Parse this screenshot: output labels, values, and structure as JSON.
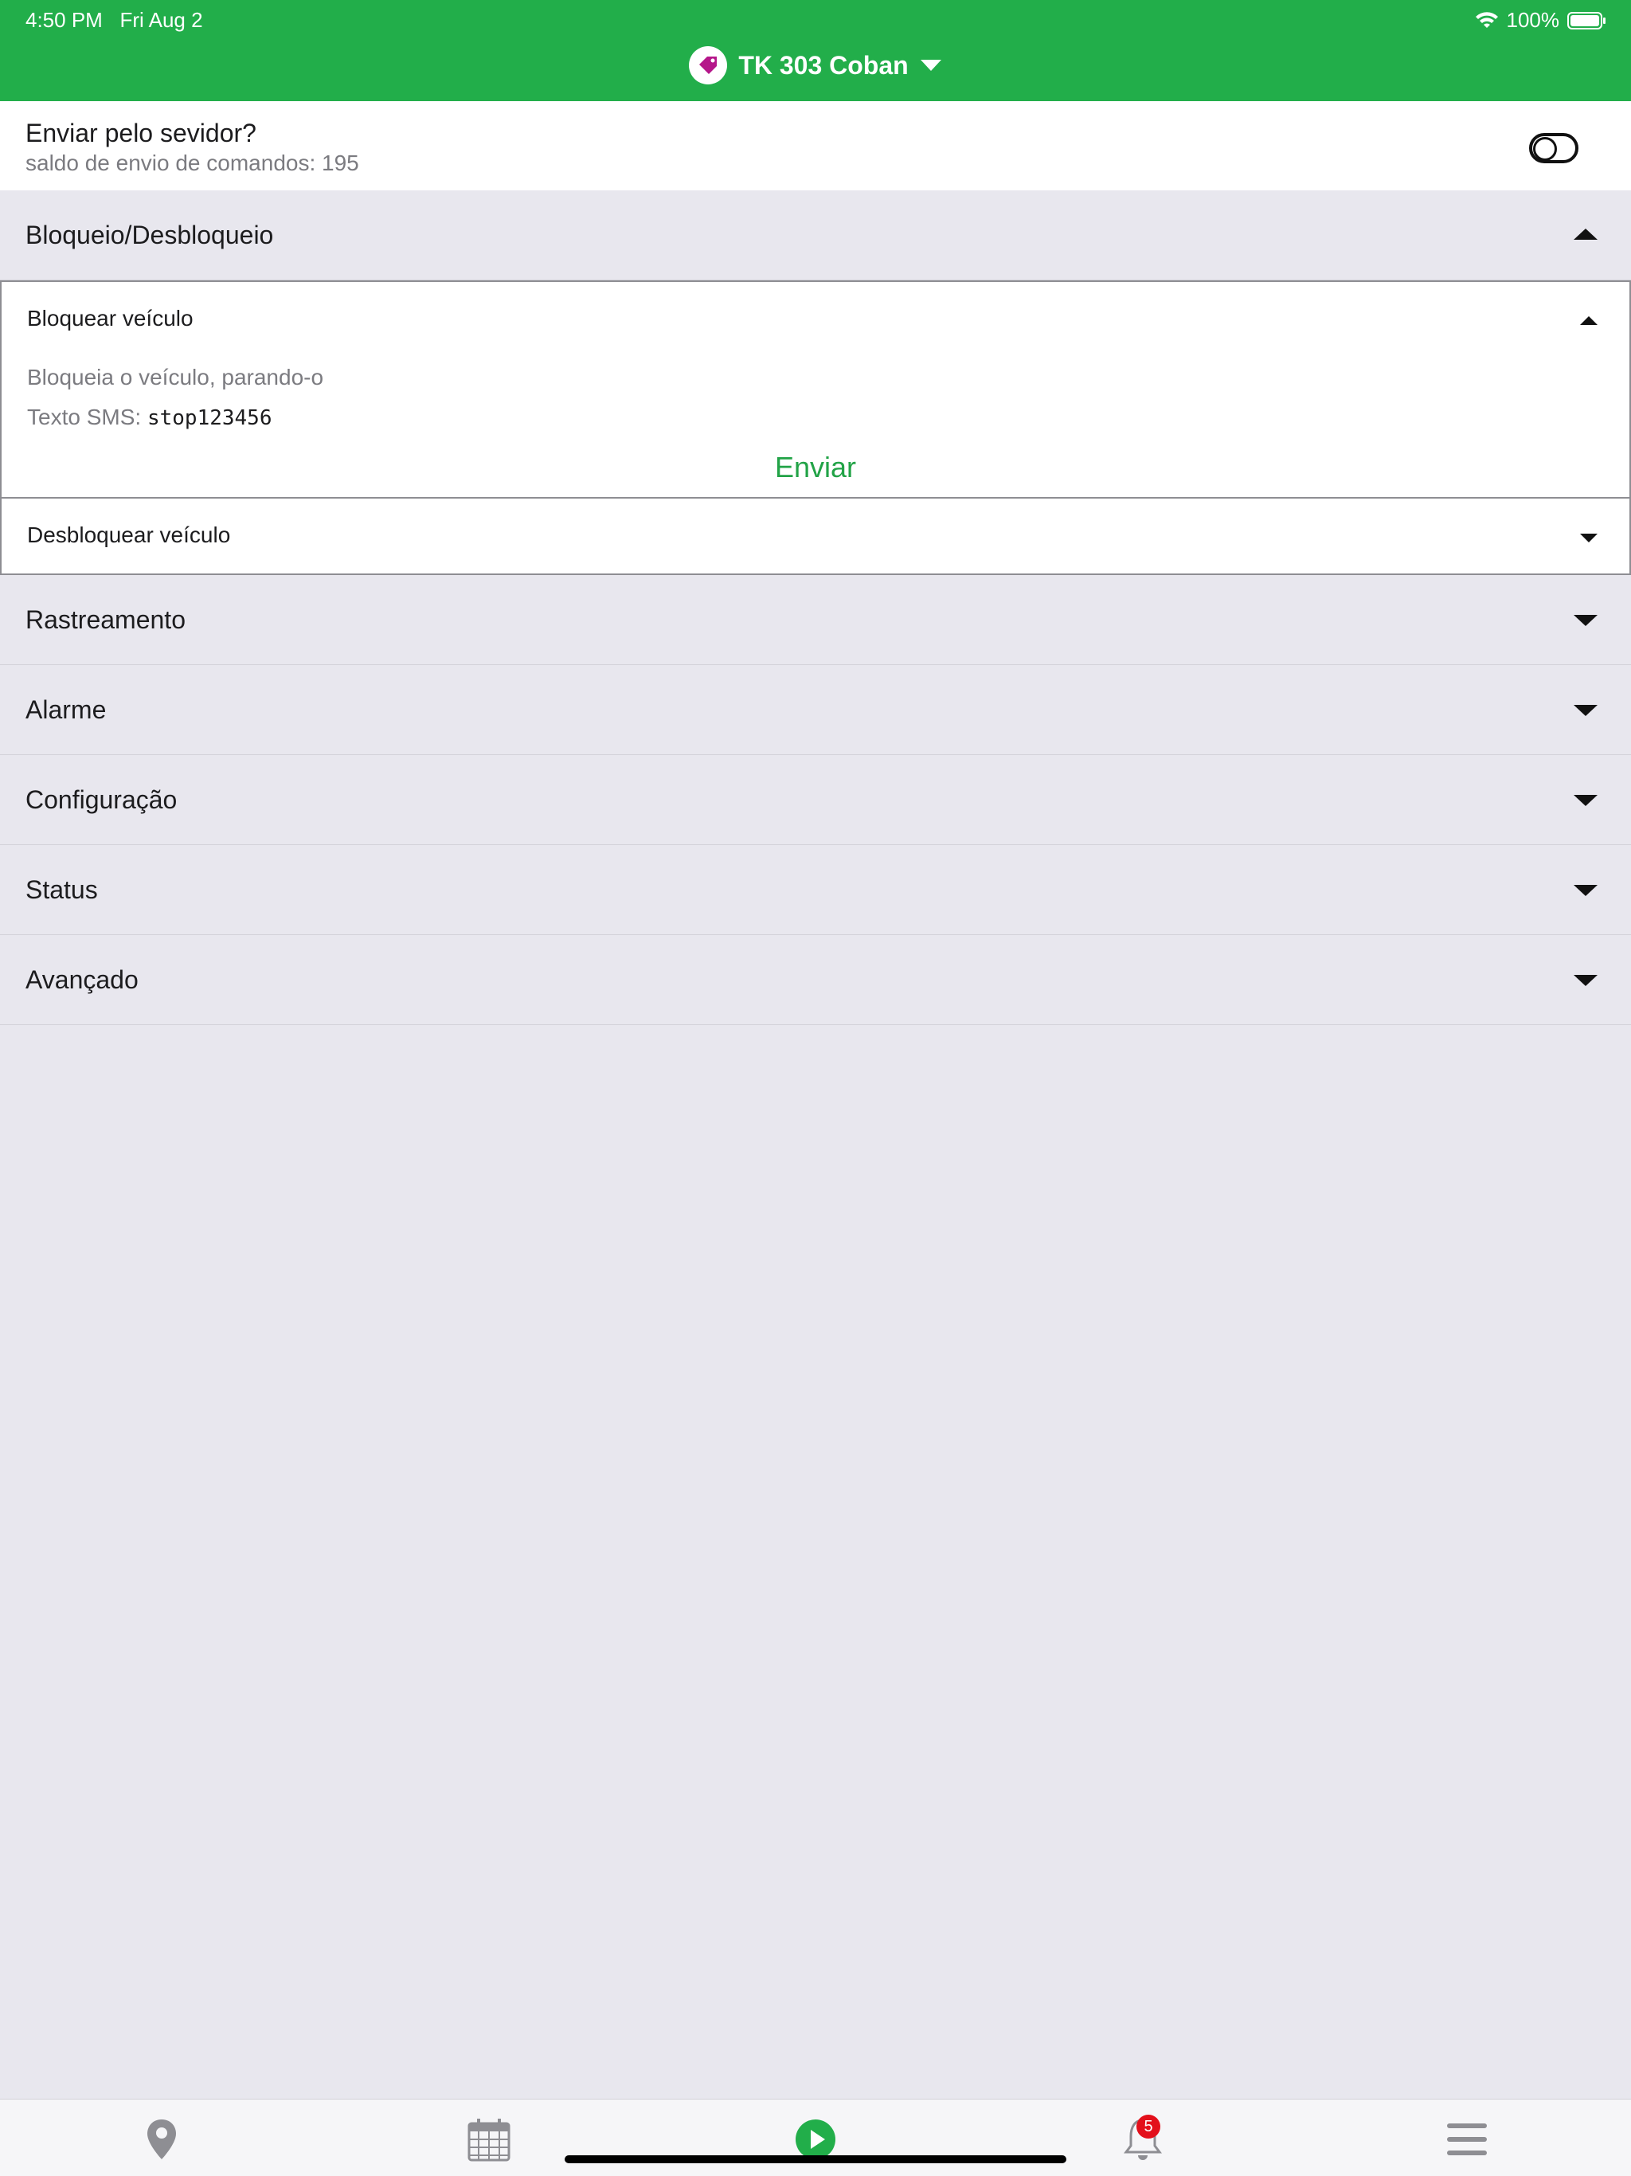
{
  "status_bar": {
    "time": "4:50 PM",
    "date": "Fri Aug 2",
    "battery": "100%"
  },
  "header": {
    "title": "TK 303 Coban",
    "accent_color": "#22ae4a"
  },
  "server": {
    "title": "Enviar pelo sevidor?",
    "subtitle": "saldo de envio de comandos: 195",
    "toggle_on": false
  },
  "sections": [
    {
      "label": "Bloqueio/Desbloqueio",
      "expanded": true
    },
    {
      "label": "Rastreamento",
      "expanded": false
    },
    {
      "label": "Alarme",
      "expanded": false
    },
    {
      "label": "Configuração",
      "expanded": false
    },
    {
      "label": "Status",
      "expanded": false
    },
    {
      "label": "Avançado",
      "expanded": false
    }
  ],
  "commands": [
    {
      "label": "Bloquear veículo",
      "expanded": true,
      "description": "Bloqueia o veículo, parando-o",
      "sms_label": "Texto SMS:",
      "sms_text": "stop123456",
      "send_label": "Enviar"
    },
    {
      "label": "Desbloquear veículo",
      "expanded": false
    }
  ],
  "tabbar": {
    "items": [
      "map-pin-icon",
      "calendar-icon",
      "play-icon",
      "bell-icon",
      "menu-icon"
    ],
    "notification_count": "5"
  }
}
